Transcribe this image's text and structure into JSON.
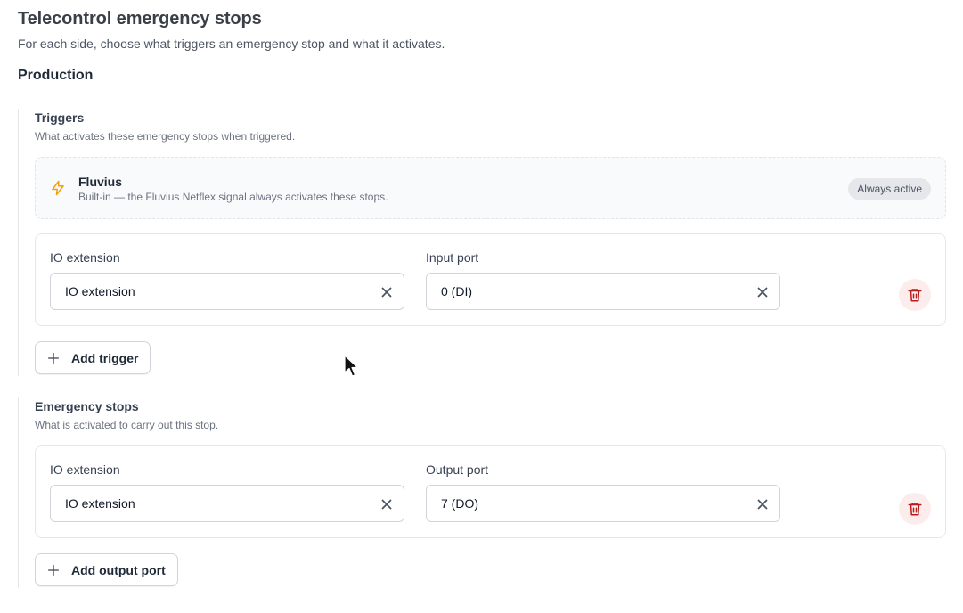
{
  "page": {
    "title": "Telecontrol emergency stops",
    "subtitle": "For each side, choose what triggers an emergency stop and what it activates."
  },
  "section": {
    "title": "Production"
  },
  "triggers": {
    "title": "Triggers",
    "description": "What activates these emergency stops when triggered.",
    "builtin": {
      "name": "Fluvius",
      "description": "Built-in — the Fluvius Netflex signal always activates these stops.",
      "badge": "Always active",
      "icon": "lightning-bolt-icon"
    },
    "row": {
      "field_a_label": "IO extension",
      "field_a_value": "IO extension",
      "field_b_label": "Input port",
      "field_b_value": "0 (DI)"
    },
    "add_label": "Add trigger"
  },
  "stops": {
    "title": "Emergency stops",
    "description": "What is activated to carry out this stop.",
    "row": {
      "field_a_label": "IO extension",
      "field_a_value": "IO extension",
      "field_b_label": "Output port",
      "field_b_value": "7 (DO)"
    },
    "add_label": "Add output port"
  },
  "colors": {
    "accent_bolt": "#f59e0b",
    "delete_icon": "#b91c1c",
    "delete_bg": "#fdecec"
  }
}
